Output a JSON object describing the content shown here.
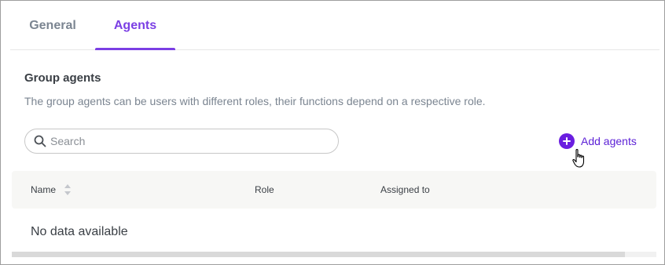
{
  "tabs": [
    {
      "label": "General",
      "active": false
    },
    {
      "label": "Agents",
      "active": true
    }
  ],
  "section": {
    "title": "Group agents",
    "description": "The group agents can be users with different roles, their functions depend on a respective role."
  },
  "search": {
    "placeholder": "Search",
    "value": "",
    "icon": "search-icon"
  },
  "add_agents": {
    "label": "Add agents",
    "icon": "plus-circle-icon"
  },
  "table": {
    "columns": [
      {
        "label": "Name",
        "sortable": true
      },
      {
        "label": "Role",
        "sortable": false
      },
      {
        "label": "Assigned to",
        "sortable": false
      }
    ],
    "empty_text": "No data available"
  },
  "colors": {
    "accent": "#7b3fe4",
    "accent_dark": "#6a1ee0",
    "muted_text": "#7b8591",
    "header_bg": "#f7f7f5"
  }
}
